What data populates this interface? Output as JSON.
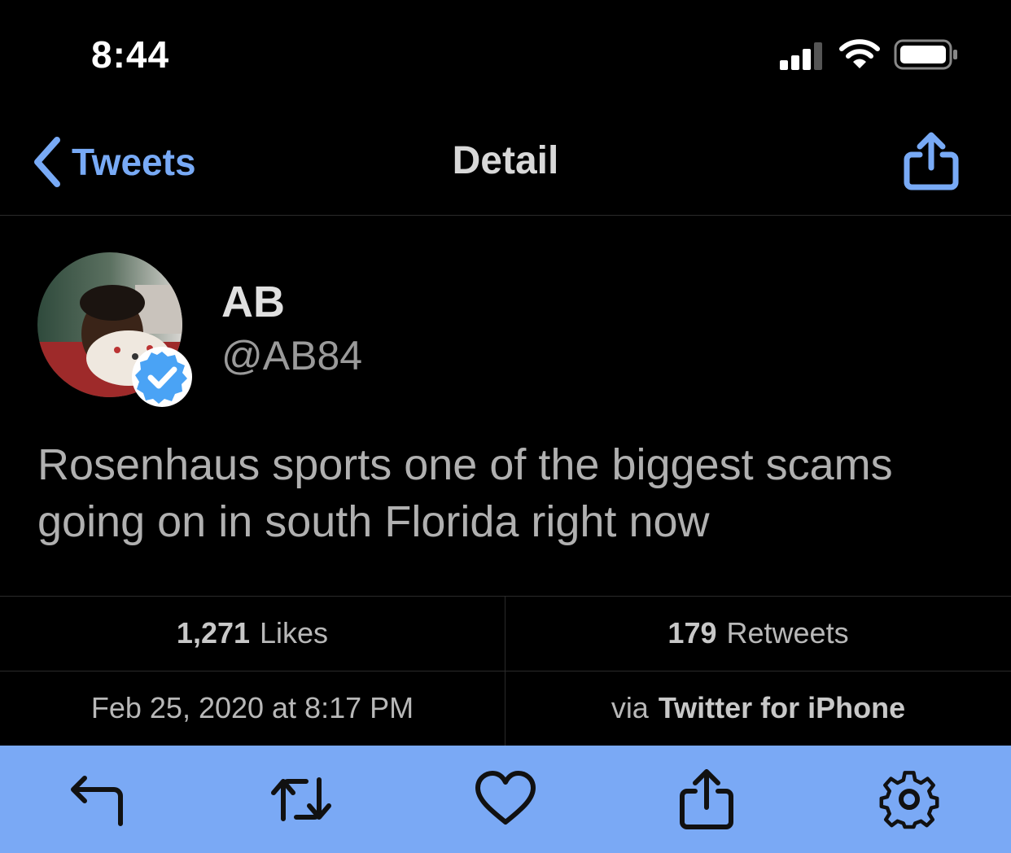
{
  "status_bar": {
    "time": "8:44",
    "signal_icon": "cellular-signal-icon",
    "wifi_icon": "wifi-icon",
    "battery_icon": "battery-icon"
  },
  "nav": {
    "back_label": "Tweets",
    "title": "Detail",
    "share_icon": "share-icon"
  },
  "tweet": {
    "author_name": "AB",
    "author_handle": "@AB84",
    "verified": true,
    "text": "Rosenhaus sports one of the biggest scams going on in south Florida right now"
  },
  "stats": {
    "likes_count": "1,271",
    "likes_label": "Likes",
    "retweets_count": "179",
    "retweets_label": "Retweets",
    "timestamp": "Feb 25, 2020 at 8:17 PM",
    "via_prefix": "via",
    "source": "Twitter for iPhone"
  },
  "toolbar": {
    "items": [
      "reply-icon",
      "retweet-icon",
      "like-icon",
      "share-icon",
      "settings-icon"
    ]
  },
  "colors": {
    "accent": "#78aaf6",
    "toolbar_bg": "#7aa9f5",
    "background": "#000000",
    "verified": "#4aa3f5"
  }
}
